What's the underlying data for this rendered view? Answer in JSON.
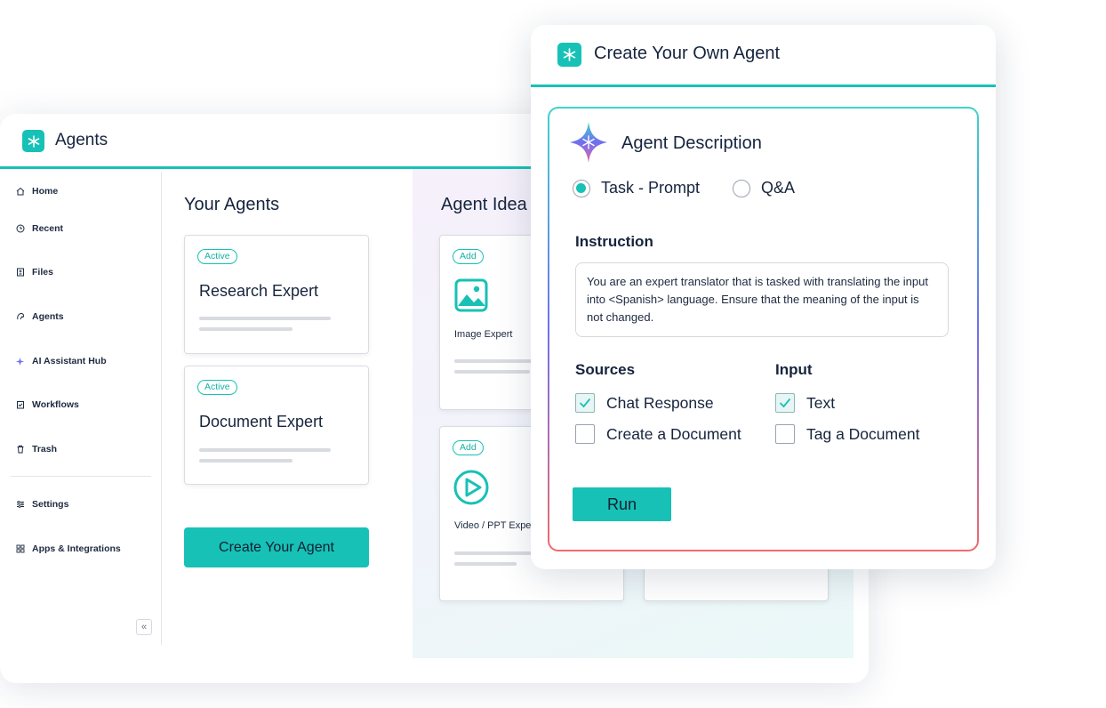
{
  "back_window": {
    "title": "Agents",
    "sidebar": {
      "items": [
        {
          "label": "Home",
          "icon": "home-icon"
        },
        {
          "label": "Recent",
          "icon": "clock-icon"
        },
        {
          "label": "Files",
          "icon": "file-icon"
        },
        {
          "label": "Agents",
          "icon": "agent-icon"
        },
        {
          "label": "AI Assistant Hub",
          "icon": "sparkle-icon"
        },
        {
          "label": "Workflows",
          "icon": "workflow-icon"
        },
        {
          "label": "Trash",
          "icon": "trash-icon"
        },
        {
          "label": "Settings",
          "icon": "sliders-icon"
        },
        {
          "label": "Apps & Integrations",
          "icon": "apps-icon"
        }
      ],
      "collapse_glyph": "«"
    },
    "your_agents": {
      "title": "Your Agents",
      "cards": [
        {
          "badge": "Active",
          "name": "Research Expert"
        },
        {
          "badge": "Active",
          "name": "Document Expert"
        }
      ],
      "create_button": "Create Your Agent"
    },
    "agent_ideas": {
      "title": "Agent Idea",
      "cards": [
        {
          "badge": "Add",
          "name": "Image Expert",
          "icon": "image-icon"
        },
        {
          "badge": "Add",
          "name": "Video / PPT Expe",
          "icon": "play-icon"
        }
      ]
    }
  },
  "front_window": {
    "title": "Create Your Own Agent",
    "section_title": "Agent Description",
    "modes": [
      {
        "label": "Task - Prompt",
        "selected": true
      },
      {
        "label": "Q&A",
        "selected": false
      }
    ],
    "instruction_label": "Instruction",
    "instruction_text": "You are an expert translator that is tasked with translating the input into <Spanish> language. Ensure that the meaning of the input is not changed.",
    "sources_label": "Sources",
    "sources": [
      {
        "label": "Chat Response",
        "checked": true
      },
      {
        "label": "Create a Document",
        "checked": false
      }
    ],
    "input_label": "Input",
    "inputs": [
      {
        "label": "Text",
        "checked": true
      },
      {
        "label": "Tag a Document",
        "checked": false
      }
    ],
    "run_button": "Run"
  },
  "colors": {
    "accent": "#17c1b6",
    "text": "#16243d",
    "gradient": [
      "#3fd3ca",
      "#6f6ff0",
      "#f06a6a"
    ]
  }
}
